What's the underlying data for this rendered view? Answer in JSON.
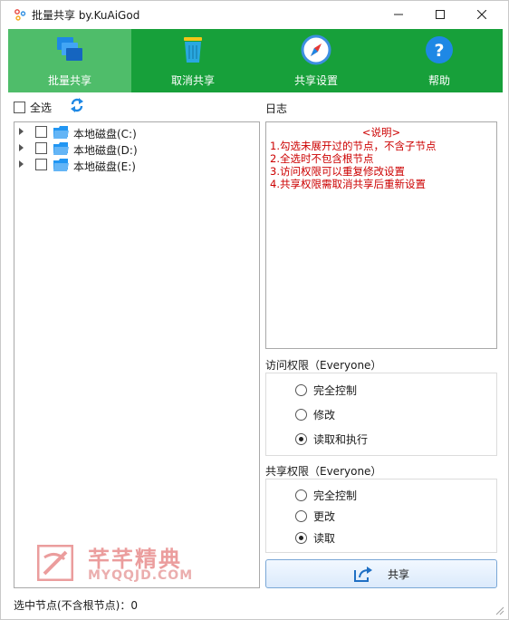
{
  "window": {
    "title": "批量共享 by.KuAiGod"
  },
  "toolbar": {
    "items": [
      {
        "label": "批量共享",
        "icon": "batch-share-icon",
        "active": true
      },
      {
        "label": "取消共享",
        "icon": "trash-icon",
        "active": false
      },
      {
        "label": "共享设置",
        "icon": "compass-icon",
        "active": false
      },
      {
        "label": "帮助",
        "icon": "help-icon",
        "active": false
      }
    ],
    "color": "#17a03a",
    "active_color": "#4fbd6a"
  },
  "left": {
    "select_all_label": "全选",
    "tree": [
      {
        "label": "本地磁盘(C:)"
      },
      {
        "label": "本地磁盘(D:)"
      },
      {
        "label": "本地磁盘(E:)"
      }
    ]
  },
  "log": {
    "label": "日志",
    "title": "<说明>",
    "lines": [
      "1.勾选未展开过的节点，不含子节点",
      "2.全选时不包含根节点",
      "3.访问权限可以重复修改设置",
      "4.共享权限需取消共享后重新设置"
    ],
    "text_color": "#cc0000"
  },
  "access": {
    "label": "访问权限（Everyone）",
    "options": [
      "完全控制",
      "修改",
      "读取和执行"
    ],
    "selected_index": 2
  },
  "share_perm": {
    "label": "共享权限（Everyone）",
    "options": [
      "完全控制",
      "更改",
      "读取"
    ],
    "selected_index": 2
  },
  "share_button": {
    "label": "共享"
  },
  "status": {
    "text": "选中节点(不含根节点)：0"
  },
  "watermark": {
    "name": "芊芊精典",
    "site": "MYQQJD.COM"
  }
}
